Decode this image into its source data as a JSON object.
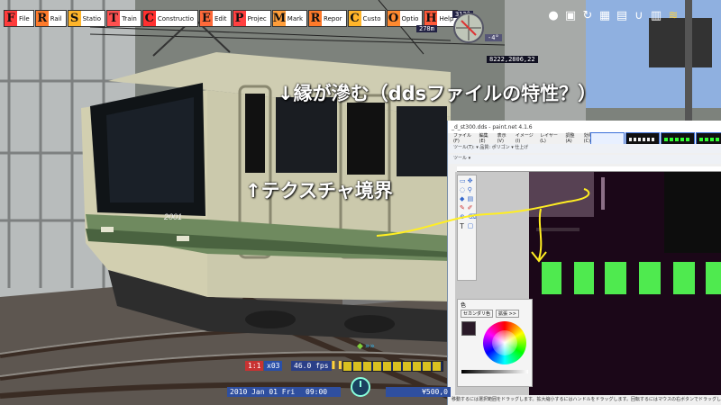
{
  "menu": [
    {
      "cap": "F",
      "label": "File",
      "color": "#ff3b3b"
    },
    {
      "cap": "R",
      "label": "Rail",
      "color": "#ff7a2a"
    },
    {
      "cap": "S",
      "label": "Statio",
      "color": "#ffb52a"
    },
    {
      "cap": "T",
      "label": "Train",
      "color": "#ff5050"
    },
    {
      "cap": "C",
      "label": "Constructio",
      "color": "#ff3030"
    },
    {
      "cap": "E",
      "label": "Edit",
      "color": "#ff6a3a"
    },
    {
      "cap": "P",
      "label": "Projec",
      "color": "#ff4040"
    },
    {
      "cap": "M",
      "label": "Mark",
      "color": "#ff9e3a"
    },
    {
      "cap": "R",
      "label": "Repor",
      "color": "#ff7a2a"
    },
    {
      "cap": "C",
      "label": "Custo",
      "color": "#ffb52a"
    },
    {
      "cap": "O",
      "label": "Optio",
      "color": "#ff8a30"
    },
    {
      "cap": "H",
      "label": "Help",
      "color": "#ff5a3a"
    }
  ],
  "hud_top": {
    "heading": "312°",
    "distance": "278m",
    "angle": "-4°",
    "coords": "8222,2806,22"
  },
  "toolbar_icons": [
    "circle-shape-icon",
    "camera-icon",
    "refresh-icon",
    "grid-icon",
    "calendar-icon",
    "magnet-icon",
    "train-icon",
    "layers-icon"
  ],
  "annotations": {
    "top": "↓縁が滲む（ddsファイルの特性？）",
    "left": "↑テクスチャ境界"
  },
  "train_number": "2001",
  "paintnet": {
    "title": "_d_st300.dds - paint.net 4.1.6",
    "menu": [
      "ファイル(F)",
      "編集(E)",
      "表示(V)",
      "イメージ(I)",
      "レイヤー(L)",
      "調整(A)",
      "効果(C)"
    ],
    "toolbar1": "ツール(T):   ▾   品質: ポリゴン   ▾   仕上げ",
    "toolbar2": "ツール ▾",
    "color_panel_title": "色",
    "primary_label": "セカンダリ色",
    "more_label": "拡張 >>",
    "status": "移動するには選択範囲をドラッグします。拡大縮小するにはハンドルをドラッグします。回転するにはマウスの右ボタンでドラッグします。"
  },
  "hud_bottom": {
    "scale": "1:1",
    "multiplier": "x03",
    "fps": "46.0 fps",
    "date": "2010  Jan  01  Fri",
    "time": "09:00",
    "money": "¥500,0"
  }
}
